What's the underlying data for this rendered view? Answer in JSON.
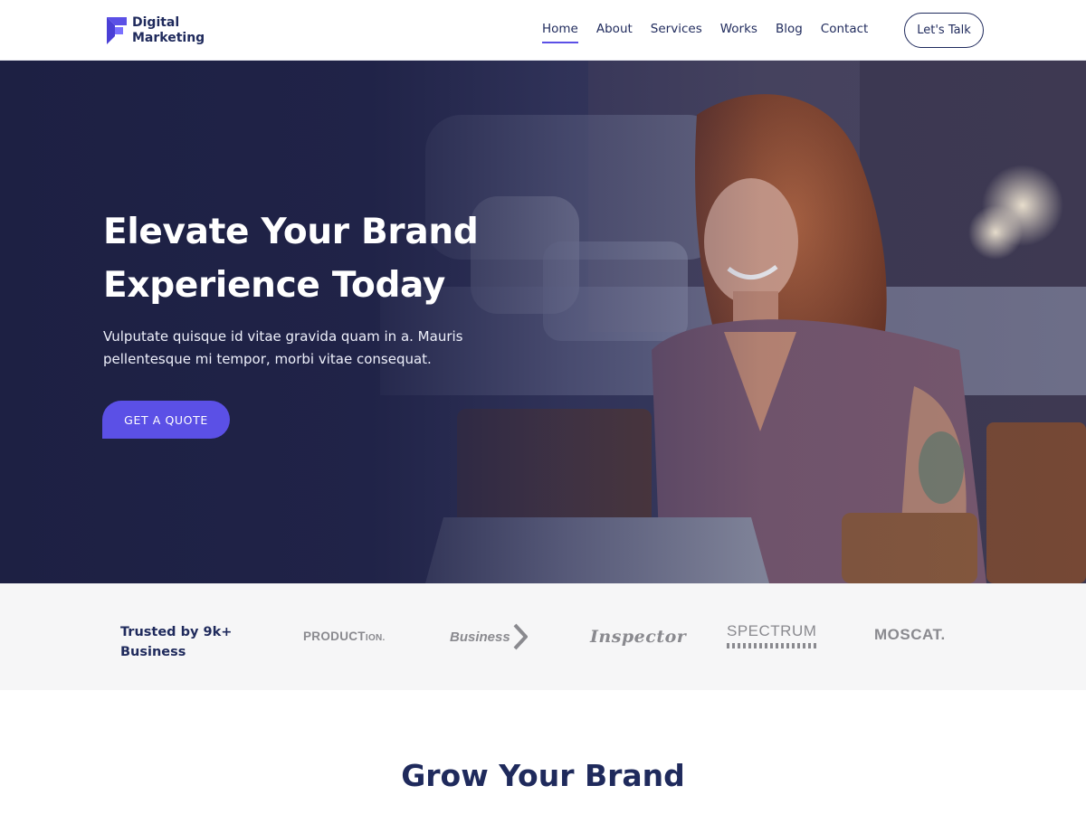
{
  "header": {
    "logo_line1": "Digital",
    "logo_line2": "Marketing",
    "logo_icon": "ribbon-logo-icon",
    "nav": [
      {
        "label": "Home",
        "active": true
      },
      {
        "label": "About",
        "active": false
      },
      {
        "label": "Services",
        "active": false
      },
      {
        "label": "Works",
        "active": false
      },
      {
        "label": "Blog",
        "active": false
      },
      {
        "label": "Contact",
        "active": false
      }
    ],
    "cta_label": "Let's Talk"
  },
  "hero": {
    "title_line1": "Elevate Your Brand",
    "title_line2": "Experience Today",
    "subtitle_line1": "Vulputate quisque id vitae gravida quam in a. Mauris",
    "subtitle_line2": "pellentesque mi tempor, morbi vitae consequat.",
    "button_label": "GET A QUOTE"
  },
  "trusted": {
    "label_line1": "Trusted by 9k+",
    "label_line2": "Business",
    "brands": {
      "production_main": "PRODUCT",
      "production_small": "ION.",
      "business": "Business",
      "inspector": "Inspector",
      "spectrum": "SPECTRUM",
      "moscat": "MOSCAT."
    }
  },
  "section": {
    "title": "Grow Your Brand"
  },
  "colors": {
    "accent": "#5b50e6",
    "navy": "#1f2a5c",
    "strip_bg": "#f6f6f7",
    "brand_gray": "#8a8a8f"
  }
}
